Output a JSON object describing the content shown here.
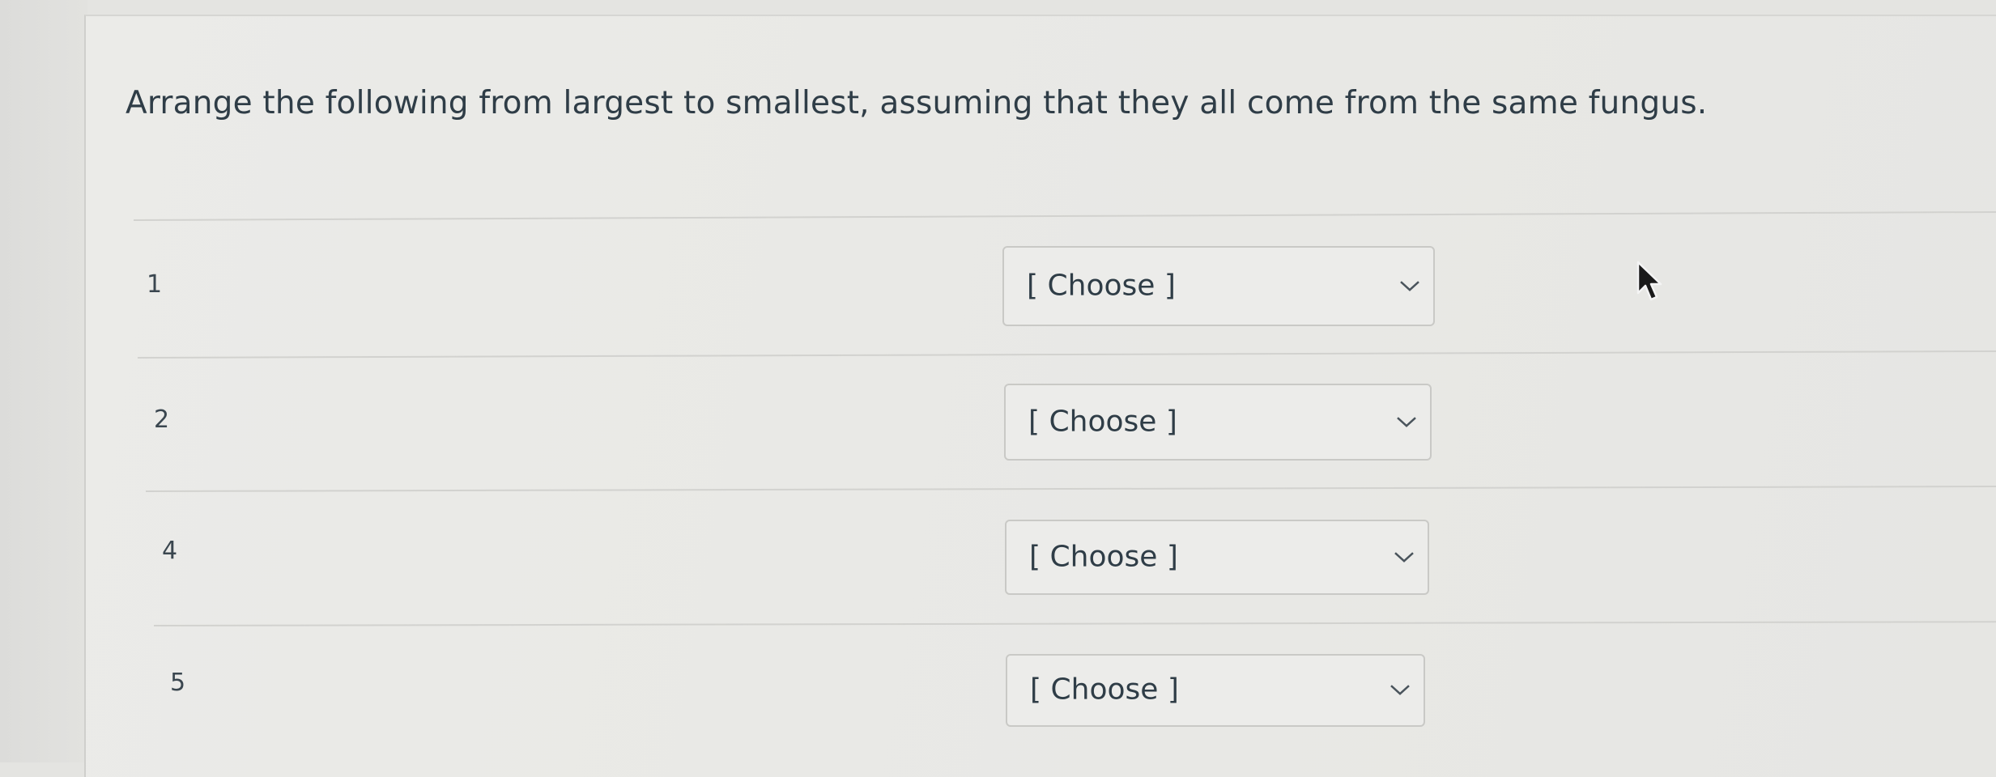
{
  "question": {
    "text": "Arrange the following from largest to smallest, assuming that they all come from the same fungus."
  },
  "rows": [
    {
      "number": "1",
      "select_value": "[ Choose ]"
    },
    {
      "number": "2",
      "select_value": "[ Choose ]"
    },
    {
      "number": "4",
      "select_value": "[ Choose ]"
    },
    {
      "number": "5",
      "select_value": "[ Choose ]"
    }
  ],
  "icons": {
    "dropdown": "chevron-down-icon",
    "pointer": "mouse-cursor-icon"
  },
  "colors": {
    "background": "#e9e9e6",
    "text": "#2f3d47",
    "border": "#c9c9c6"
  }
}
